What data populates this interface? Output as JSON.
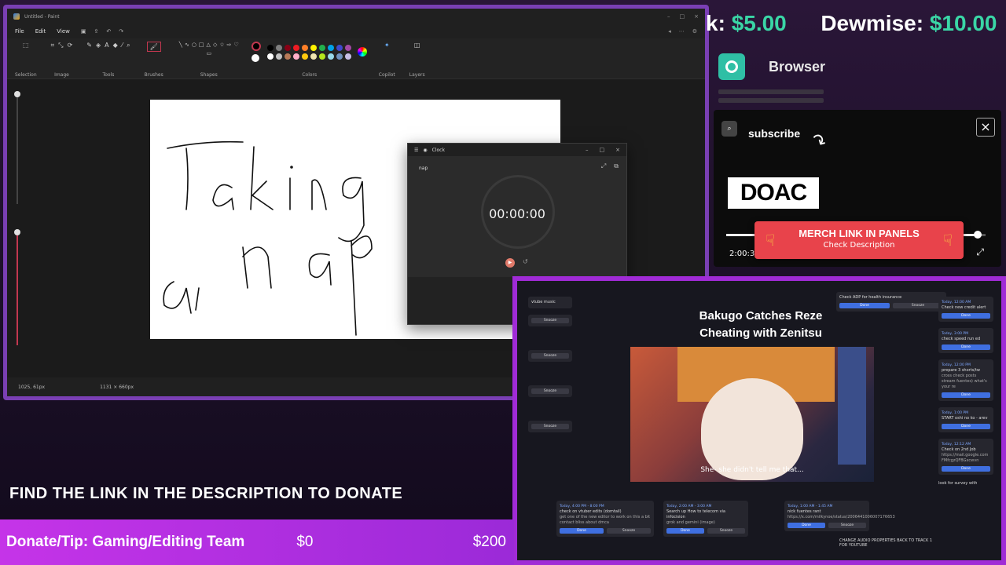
{
  "paint": {
    "title": "Untitled - Paint",
    "menu": [
      "File",
      "Edit",
      "View"
    ],
    "ribbon_groups": [
      "Selection",
      "Image",
      "Tools",
      "Brushes",
      "Shapes",
      "Colors",
      "Copilot",
      "Layers"
    ],
    "status_cursor": "1025, 61px",
    "status_size": "1131 × 660px",
    "swatch_colors": [
      "#000000",
      "#7f7f7f",
      "#880015",
      "#ed1c24",
      "#ff7f27",
      "#fff200",
      "#22b14c",
      "#00a2e8",
      "#3f48cc",
      "#a349a4",
      "#ffffff",
      "#c3c3c3",
      "#b97a57",
      "#ffaec9",
      "#ffc90e",
      "#efe4b0",
      "#b5e61d",
      "#99d9ea",
      "#7092be",
      "#c8bfe7"
    ]
  },
  "clock": {
    "title": "Clock",
    "name": "nap",
    "time": "00:00:00"
  },
  "ticker": {
    "prefix_name": "k:",
    "prefix_amount": "$5.00",
    "name": "Dewmise:",
    "amount": "$10.00"
  },
  "browser": {
    "label": "Browser"
  },
  "promo": {
    "subscribe": "subscribe",
    "brand": "DOAC",
    "time": "2:00:3",
    "progress": 0.97,
    "merch_title": "MERCH LINK IN PANELS",
    "merch_sub": "Check Description"
  },
  "video": {
    "title": "Bakugo Catches Reze Cheating with Zenitsu",
    "subtitle": "She- she didn't tell me that...",
    "top_task": "Check ADP for health insurance",
    "tasks_bottom": [
      {
        "when": "Today, 4:00 PM - 8:00 PM",
        "title": "check on vtuber edits (domtail)",
        "note": "get one of the new editor to work on this a bit contact bliss about dmca"
      },
      {
        "when": "Today, 2:00 AM - 3:00 AM",
        "title": "Search up How to telecom via infocision",
        "note": "grok and gemini (image)"
      },
      {
        "when": "Today, 1:00 AM - 1:45 AM",
        "title": "nick fuentes rant",
        "note": "https://x.com/milkynoe/status/2006441006007176653"
      }
    ],
    "tasks_right": [
      {
        "when": "Today, 12:00 AM",
        "title": "Check new credit alert"
      },
      {
        "when": "Today, 3:00 PM",
        "title": "check speed run ed"
      },
      {
        "when": "Today, 12:00 PM",
        "title": "prepare 3 shorts/tw",
        "note": "cross check posts stream fuentes) what's your re"
      },
      {
        "when": "Today, 1:00 PM",
        "title": "START oshi no ko - arev"
      },
      {
        "when": "Today, 12:12 AM",
        "title": "Check on 2nd Job",
        "note": "https://mail.google.com FMfcgzQFBGxcwvn"
      }
    ],
    "left_labels": [
      "vtube music",
      "Snooze",
      "Snooze",
      "Snooze",
      "Snooze"
    ],
    "right_bottom_1": "CHANGE AUDIO PROPERTIES BACK TO TRACK 1 FOR YOUTUBE",
    "right_bottom_2": "look for survey with",
    "done_label": "Done",
    "snooze_label": "Snooze"
  },
  "donate": {
    "banner": "FIND THE LINK IN THE DESCRIPTION TO DONATE",
    "label": "Donate/Tip: Gaming/Editing Team",
    "current": "$0",
    "goal": "$200"
  }
}
